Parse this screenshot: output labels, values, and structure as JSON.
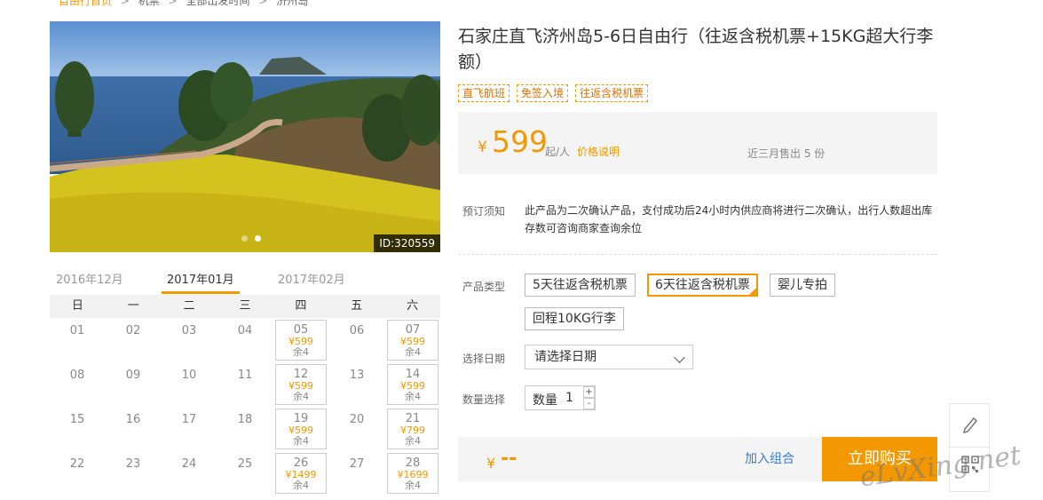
{
  "breadcrumb": [
    {
      "label": "自由行首页"
    },
    {
      "label": "机票"
    },
    {
      "label": "全部出发时间"
    },
    {
      "label": "济州岛"
    }
  ],
  "photo": {
    "id_label": "ID:320559"
  },
  "calendar": {
    "months": [
      "2016年12月",
      "2017年01月",
      "2017年02月"
    ],
    "active_month_index": 1,
    "weekdays": [
      "日",
      "一",
      "二",
      "三",
      "四",
      "五",
      "六"
    ],
    "weeks": [
      [
        {
          "d": "01"
        },
        {
          "d": "02"
        },
        {
          "d": "03"
        },
        {
          "d": "04"
        },
        {
          "d": "05",
          "p": "¥599",
          "r": "余4"
        },
        {
          "d": "06"
        },
        {
          "d": "07",
          "p": "¥599",
          "r": "余4"
        }
      ],
      [
        {
          "d": "08"
        },
        {
          "d": "09"
        },
        {
          "d": "10"
        },
        {
          "d": "11"
        },
        {
          "d": "12",
          "p": "¥599",
          "r": "余4"
        },
        {
          "d": "13"
        },
        {
          "d": "14",
          "p": "¥599",
          "r": "余4"
        }
      ],
      [
        {
          "d": "15"
        },
        {
          "d": "16"
        },
        {
          "d": "17"
        },
        {
          "d": "18"
        },
        {
          "d": "19",
          "p": "¥599",
          "r": "余4"
        },
        {
          "d": "20"
        },
        {
          "d": "21",
          "p": "¥799",
          "r": "余4"
        }
      ],
      [
        {
          "d": "22"
        },
        {
          "d": "23"
        },
        {
          "d": "24"
        },
        {
          "d": "25"
        },
        {
          "d": "26",
          "p": "¥1499",
          "r": "余4"
        },
        {
          "d": "27"
        },
        {
          "d": "28",
          "p": "¥1699",
          "r": "余4"
        }
      ]
    ]
  },
  "product": {
    "title": "石家庄直飞济州岛5-6日自由行（往返含税机票+15KG超大行李额）",
    "tags": [
      "直飞航班",
      "免签入境",
      "往返含税机票"
    ],
    "price_symbol": "¥",
    "price": "599",
    "price_unit": "起/人",
    "price_link": "价格说明",
    "sold": "近三月售出 5 份"
  },
  "booking": {
    "notice_label": "预订须知",
    "notice_text": "此产品为二次确认产品，支付成功后24小时内供应商将进行二次确认，出行人数超出库存数可咨询商家查询余位",
    "type_label": "产品类型",
    "types": [
      "5天往返含税机票",
      "6天往返含税机票",
      "婴儿专拍",
      "回程10KG行李"
    ],
    "selected_type_index": 1,
    "date_label": "选择日期",
    "date_value": "请选择日期",
    "qty_label": "数量选择",
    "qty_field_label": "数量",
    "qty_value": "1",
    "qty_plus": "+",
    "qty_minus": "-"
  },
  "buybar": {
    "total_symbol": "¥",
    "total_value": "--",
    "add_combo": "加入组合",
    "buy_now": "立即购买"
  },
  "watermark": "eLvXing.net",
  "colors": {
    "accent": "#f39800",
    "link": "#3a7cc9"
  }
}
